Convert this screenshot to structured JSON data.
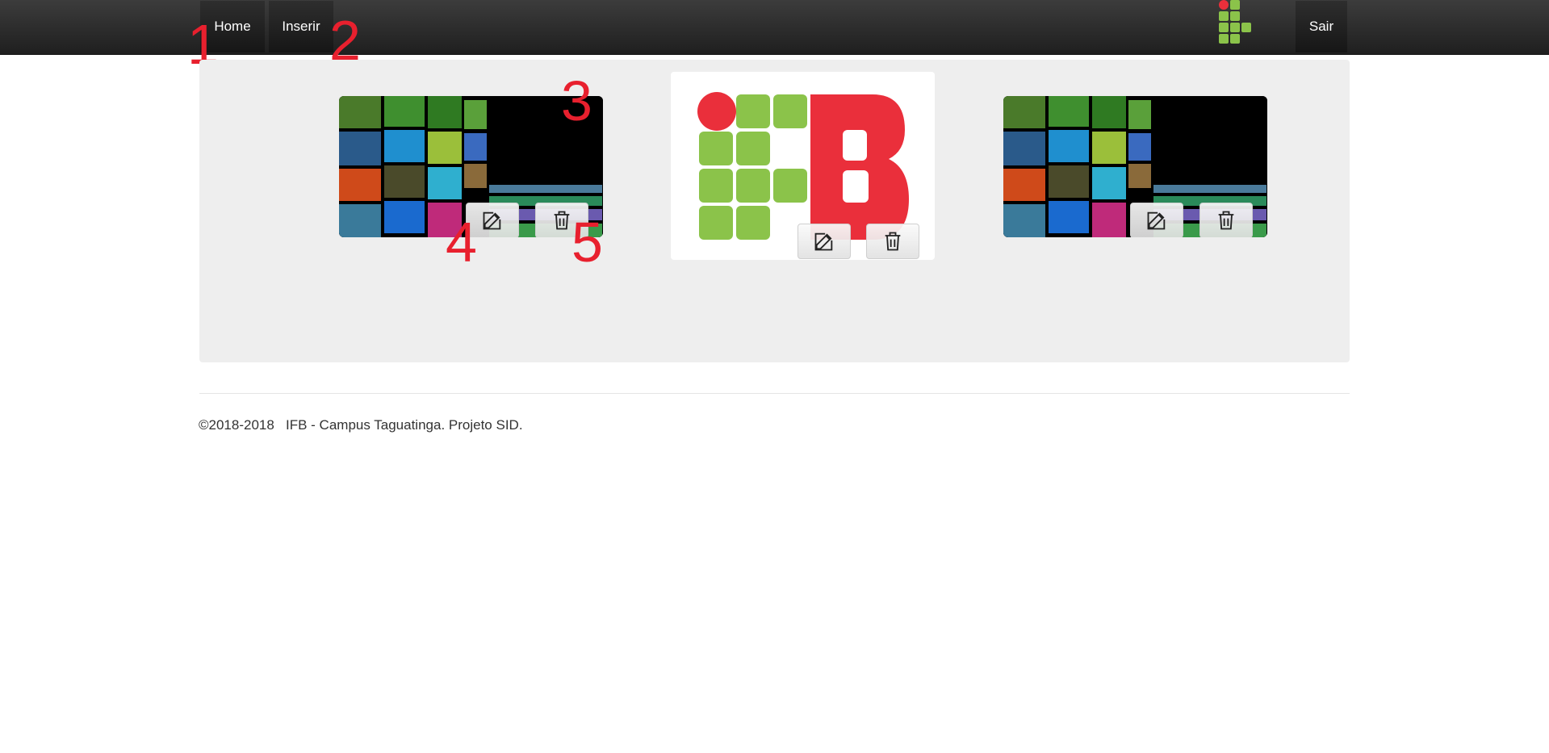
{
  "nav": {
    "home_label": "Home",
    "inserir_label": "Inserir",
    "sair_label": "Sair",
    "logo_icon": "ifb-logo-icon"
  },
  "gallery": {
    "items": [
      {
        "image": "media-wall-image",
        "edit_icon": "edit-icon",
        "delete_icon": "trash-icon"
      },
      {
        "image": "ifb-logo-image",
        "edit_icon": "edit-icon",
        "delete_icon": "trash-icon"
      },
      {
        "image": "media-wall-image",
        "edit_icon": "edit-icon",
        "delete_icon": "trash-icon"
      }
    ]
  },
  "annotations": [
    "1",
    "2",
    "3",
    "4",
    "5"
  ],
  "footer": {
    "text": "©2018-2018   IFB - Campus Taguatinga. Projeto SID."
  },
  "colors": {
    "ifb_green": "#8bc34a",
    "ifb_red": "#ea2f3b",
    "annotation_red": "#e8202e",
    "navbar_dark": "#2a2a2a",
    "panel_gray": "#eeeeee"
  }
}
